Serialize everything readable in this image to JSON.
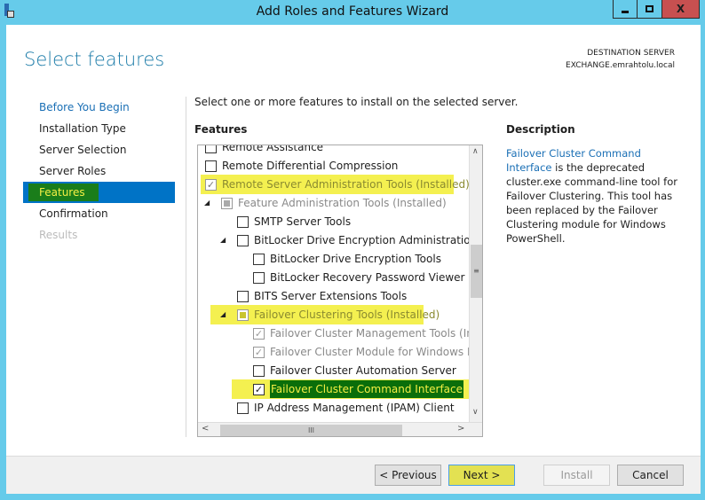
{
  "window": {
    "title": "Add Roles and Features Wizard",
    "app_icon": "server-manager-icon",
    "controls": {
      "minimize": "▁",
      "maximize": "□",
      "close": "X"
    }
  },
  "header": {
    "title": "Select features",
    "destination_label": "DESTINATION SERVER",
    "destination_server": "EXCHANGE.emrahtolu.local"
  },
  "nav": {
    "items": [
      {
        "label": "Before You Begin",
        "state": "link"
      },
      {
        "label": "Installation Type",
        "state": "normal"
      },
      {
        "label": "Server Selection",
        "state": "normal"
      },
      {
        "label": "Server Roles",
        "state": "normal"
      },
      {
        "label": "Features",
        "state": "selected"
      },
      {
        "label": "Confirmation",
        "state": "normal"
      },
      {
        "label": "Results",
        "state": "disabled"
      }
    ]
  },
  "main": {
    "instruction": "Select one or more features to install on the selected server.",
    "features_label": "Features",
    "features": [
      {
        "label": "Remote Assistance",
        "checked": false,
        "level": 0
      },
      {
        "label": "Remote Differential Compression",
        "checked": false,
        "level": 0
      },
      {
        "label": "Remote Server Administration Tools (Installed)",
        "checked": true,
        "level": 0,
        "installed": true,
        "highlight": true
      },
      {
        "label": "Feature Administration Tools (Installed)",
        "checked": "partial",
        "level": 1,
        "installed": true,
        "expanded": true
      },
      {
        "label": "SMTP Server Tools",
        "checked": false,
        "level": 2
      },
      {
        "label": "BitLocker Drive Encryption Administration Utilities",
        "checked": false,
        "level": 2,
        "expanded": true
      },
      {
        "label": "BitLocker Drive Encryption Tools",
        "checked": false,
        "level": 3
      },
      {
        "label": "BitLocker Recovery Password Viewer",
        "checked": false,
        "level": 3
      },
      {
        "label": "BITS Server Extensions Tools",
        "checked": false,
        "level": 2
      },
      {
        "label": "Failover Clustering Tools (Installed)",
        "checked": "partial",
        "level": 2,
        "installed": true,
        "expanded": true,
        "highlight": true
      },
      {
        "label": "Failover Cluster Management Tools (Installed)",
        "checked": true,
        "level": 3,
        "installed": true
      },
      {
        "label": "Failover Cluster Module for Windows PowerShell (Installed)",
        "checked": true,
        "level": 3,
        "installed": true
      },
      {
        "label": "Failover Cluster Automation Server",
        "checked": false,
        "level": 3
      },
      {
        "label": "Failover Cluster Command Interface",
        "checked": true,
        "level": 3,
        "highlight": true,
        "selected": true
      },
      {
        "label": "IP Address Management (IPAM) Client",
        "checked": false,
        "level": 2
      }
    ],
    "description_label": "Description",
    "description_link": "Failover Cluster Command Interface",
    "description_text": "is the deprecated cluster.exe command-line tool for Failover Clustering. This tool has been replaced by the Failover Clustering module for Windows PowerShell."
  },
  "footer": {
    "previous": "< Previous",
    "next": "Next >",
    "install": "Install",
    "cancel": "Cancel"
  },
  "colors": {
    "frame": "#66cbea",
    "accent": "#0073c6",
    "highlight": "#f4f050",
    "close": "#c75050"
  }
}
